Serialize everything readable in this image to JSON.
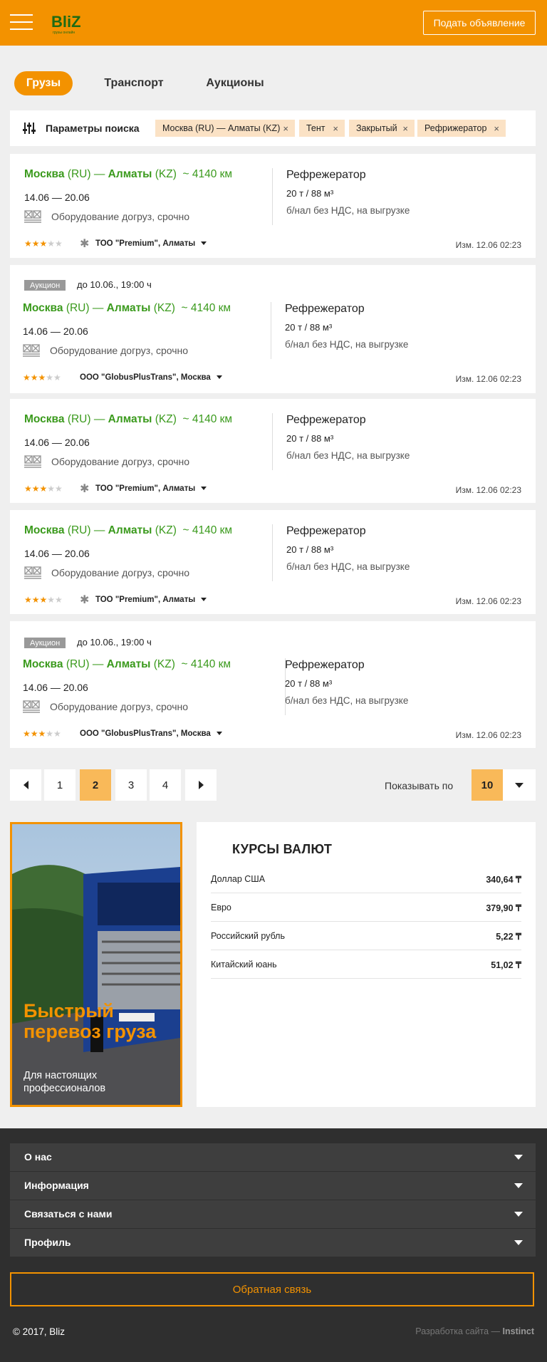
{
  "header": {
    "logo_text": "BliZ",
    "logo_tagline": "грузы онлайн",
    "post_button": "Подать объявление",
    "colors": {
      "brand": "#f39200",
      "route_green": "#3a9a1c"
    }
  },
  "tabs": [
    {
      "label": "Грузы",
      "active": true
    },
    {
      "label": "Транспорт",
      "active": false
    },
    {
      "label": "Аукционы",
      "active": false
    }
  ],
  "search": {
    "label": "Параметры поиска",
    "chips": [
      "Москва (RU) — Алматы (KZ)",
      "Тент",
      "Закрытый",
      "Рефрижератор"
    ],
    "chip_remove": "×"
  },
  "cards": [
    {
      "auction": false,
      "from_city": "Москва",
      "from_country": "(RU)",
      "dash": "—",
      "to_city": "Алматы",
      "to_country": "(KZ)",
      "distance": "~ 4140 км",
      "dates": "14.06 — 20.06",
      "equipment": "Оборудование догруз, срочно",
      "rating": 3,
      "rating_max": 5,
      "verified_mark": true,
      "company": "ТОО \"Premium\", Алматы",
      "cargo_type": "Рефрежератор",
      "weight": "20 т / 88 м³",
      "payment": "б/нал без НДС, на выгрузке",
      "changed": "Изм. 12.06  02:23"
    },
    {
      "auction": true,
      "auction_label": "Аукцион",
      "deadline": "до  10.06.,    19:00 ч",
      "from_city": "Москва",
      "from_country": "(RU)",
      "dash": "—",
      "to_city": "Алматы",
      "to_country": "(KZ)",
      "distance": "~ 4140 км",
      "dates": "14.06 — 20.06",
      "equipment": "Оборудование догруз, срочно",
      "rating": 3,
      "rating_max": 5,
      "verified_mark": false,
      "company": "ООО \"GlobusPlusTrans\", Москва",
      "cargo_type": "Рефрежератор",
      "weight": "20 т / 88 м³",
      "payment": "б/нал без НДС, на выгрузке",
      "changed": "Изм. 12.06  02:23"
    },
    {
      "auction": false,
      "from_city": "Москва",
      "from_country": "(RU)",
      "dash": "—",
      "to_city": "Алматы",
      "to_country": "(KZ)",
      "distance": "~ 4140 км",
      "dates": "14.06 — 20.06",
      "equipment": "Оборудование догруз, срочно",
      "rating": 3,
      "rating_max": 5,
      "verified_mark": true,
      "company": "ТОО \"Premium\", Алматы",
      "cargo_type": "Рефрежератор",
      "weight": "20 т / 88 м³",
      "payment": "б/нал без НДС, на выгрузке",
      "changed": "Изм. 12.06  02:23"
    },
    {
      "auction": false,
      "from_city": "Москва",
      "from_country": "(RU)",
      "dash": "—",
      "to_city": "Алматы",
      "to_country": "(KZ)",
      "distance": "~ 4140 км",
      "dates": "14.06 — 20.06",
      "equipment": "Оборудование догруз, срочно",
      "rating": 3,
      "rating_max": 5,
      "verified_mark": true,
      "company": "ТОО \"Premium\", Алматы",
      "cargo_type": "Рефрежератор",
      "weight": "20 т / 88 м³",
      "payment": "б/нал без НДС, на выгрузке",
      "changed": "Изм. 12.06  02:23"
    },
    {
      "auction": true,
      "auction_label": "Аукцион",
      "deadline": "до  10.06.,    19:00 ч",
      "from_city": "Москва",
      "from_country": "(RU)",
      "dash": "—",
      "to_city": "Алматы",
      "to_country": "(KZ)",
      "distance": "~ 4140 км",
      "dates": "14.06 — 20.06",
      "equipment": "Оборудование догруз, срочно",
      "rating": 3,
      "rating_max": 5,
      "verified_mark": false,
      "company": "ООО \"GlobusPlusTrans\", Москва",
      "cargo_type": "Рефрежератор",
      "weight": "20 т / 88 м³",
      "payment": "б/нал без НДС, на выгрузке",
      "changed": "Изм. 12.06  02:23"
    }
  ],
  "pagination": {
    "pages": [
      "1",
      "2",
      "3",
      "4"
    ],
    "current": "2",
    "show_label": "Показывать по",
    "show_value": "10"
  },
  "banner": {
    "title": "Быстрый перевоз груза",
    "subtitle": "Для настоящих профессионалов"
  },
  "rates": {
    "title": "КУРСЫ ВАЛЮТ",
    "items": [
      {
        "name": "Доллар США",
        "value": "340,64 ₸"
      },
      {
        "name": "Евро",
        "value": "379,90 ₸"
      },
      {
        "name": "Российский рубль",
        "value": "5,22 ₸"
      },
      {
        "name": "Китайский юань",
        "value": "51,02 ₸"
      }
    ]
  },
  "footer": {
    "accordion": [
      "О нас",
      "Информация",
      "Связаться с нами",
      "Профиль"
    ],
    "feedback_button": "Обратная связь",
    "copyright": "© 2017, Bliz",
    "developer_prefix": "Разработка сайта —",
    "developer_name": "Instinct"
  }
}
